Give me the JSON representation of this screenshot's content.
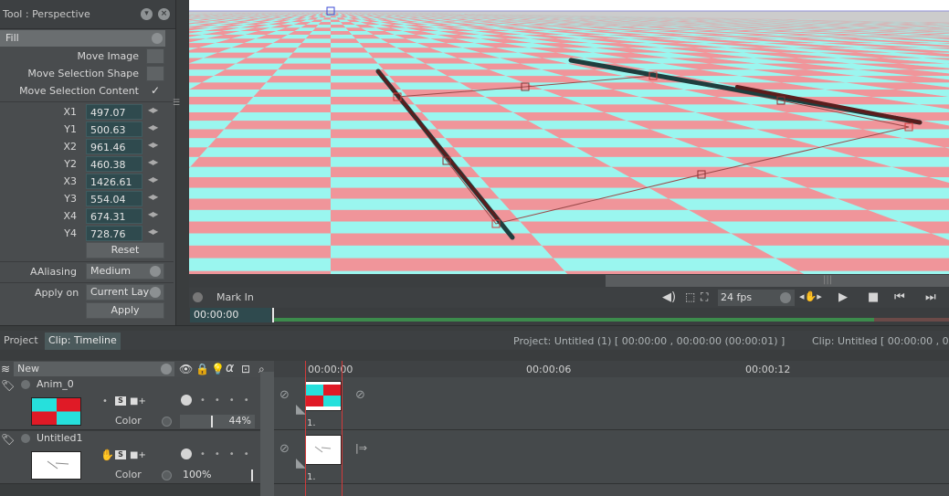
{
  "tool": {
    "title": "Tool : Perspective",
    "mode": "Fill",
    "options": [
      {
        "label": "Move Image",
        "checked": false
      },
      {
        "label": "Move Selection Shape",
        "checked": false
      },
      {
        "label": "Move Selection Content",
        "checked": true
      }
    ],
    "coords": [
      {
        "label": "X1",
        "value": "497.07"
      },
      {
        "label": "Y1",
        "value": "500.63"
      },
      {
        "label": "X2",
        "value": "961.46"
      },
      {
        "label": "Y2",
        "value": "460.38"
      },
      {
        "label": "X3",
        "value": "1426.61"
      },
      {
        "label": "Y3",
        "value": "554.04"
      },
      {
        "label": "X4",
        "value": "674.31"
      },
      {
        "label": "Y4",
        "value": "728.76"
      }
    ],
    "reset_label": "Reset",
    "aaliasing_label": "AAliasing",
    "aaliasing_value": "Medium",
    "apply_on_label": "Apply on",
    "apply_on_value": "Current Layer",
    "apply_label": "Apply",
    "check_glyph": "✓"
  },
  "playback": {
    "mark_in_label": "Mark In",
    "fps": "24 fps",
    "current_time": "00:00:00",
    "icons": [
      "volume-icon",
      "fit-icon",
      "fullscreen-icon",
      "hand-icon",
      "play-icon",
      "stop-icon",
      "rewind-icon",
      "fast-forward-icon"
    ]
  },
  "lower": {
    "tabs": [
      {
        "label": "Project",
        "active": false
      },
      {
        "label": "Clip: Timeline",
        "active": true
      }
    ],
    "project_info": "Project: Untitled (1) [ 00:00:00 , 00:00:00  (00:00:01) ]",
    "clip_info": "Clip: Untitled [ 00:00:00 , 00:0",
    "layer_filter": "New",
    "ruler": [
      "00:00:00",
      "00:00:06",
      "00:00:12"
    ],
    "layers": [
      {
        "name": "Anim_0",
        "color_label": "Color",
        "opacity": "44%",
        "opacity_fraction": 0.44,
        "cell_num": "1."
      },
      {
        "name": "Untitled1",
        "color_label": "Color",
        "opacity": "100%",
        "opacity_fraction": 1.0,
        "cell_num": "1."
      }
    ],
    "glyphs": {
      "sq": "S",
      "alpha": "α"
    }
  },
  "colors": {
    "checker_pink": "#f0959a",
    "checker_cyan": "#9af6ef",
    "handle_red": "#d23b3b",
    "track_green": "#3c8b4c"
  }
}
